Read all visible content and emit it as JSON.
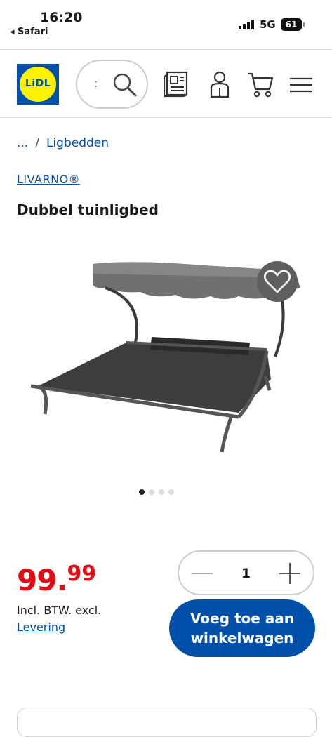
{
  "status_bar": {
    "time": "16:20",
    "back_app": "◂ Safari",
    "network": "5G",
    "battery": "61"
  },
  "header": {
    "logo_text": "LiDL",
    "search_cursor": ":",
    "icons": [
      "search-icon",
      "leaflet-icon",
      "account-icon",
      "cart-icon",
      "menu-icon"
    ]
  },
  "breadcrumb": {
    "ellipsis": "...",
    "separator": "/",
    "current": "Ligbedden"
  },
  "product": {
    "brand": "LIVARNO®",
    "title": "Dubbel tuinligbed",
    "price_main": "99.",
    "price_cents": "99",
    "incl_text": "Incl. BTW. excl.",
    "levering_link": "Levering",
    "quantity": "1",
    "add_to_cart": "Voeg toe aan winkelwagen"
  },
  "carousel": {
    "slide_count": 4,
    "active": 1
  },
  "colors": {
    "brand_blue": "#0050aa",
    "price_red": "#e60a14",
    "logo_yellow": "#fff200"
  }
}
